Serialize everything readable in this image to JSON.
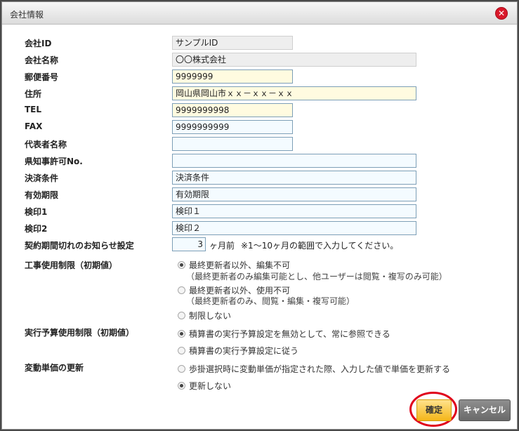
{
  "dialog": {
    "title": "会社情報",
    "close_glyph": "✕"
  },
  "fields": [
    {
      "label": "会社ID",
      "value": "サンプルID"
    },
    {
      "label": "会社名称",
      "value": "〇〇株式会社"
    },
    {
      "label": "郵便番号",
      "value": "9999999"
    },
    {
      "label": "住所",
      "value": "岡山県岡山市ｘｘ－ｘｘ－ｘｘ"
    },
    {
      "label": "TEL",
      "value": "9999999998"
    },
    {
      "label": "FAX",
      "value": "9999999999"
    },
    {
      "label": "代表者名称",
      "value": ""
    },
    {
      "label": "県知事許可No.",
      "value": ""
    },
    {
      "label": "決済条件",
      "value": "決済条件"
    },
    {
      "label": "有効期限",
      "value": "有効期限"
    },
    {
      "label": "検印1",
      "value": "検印１"
    },
    {
      "label": "検印2",
      "value": "検印２"
    }
  ],
  "notice": {
    "label": "契約期間切れのお知らせ設定",
    "value": "3",
    "unit": "ヶ月前",
    "hint": "※1～10ヶ月の範囲で入力してください。"
  },
  "construction_limit": {
    "label": "工事使用制限（初期値）",
    "options": [
      {
        "label": "最終更新者以外、編集不可",
        "sub": "（最終更新者のみ編集可能とし、他ユーザーは閲覧・複写のみ可能）",
        "checked": true
      },
      {
        "label": "最終更新者以外、使用不可",
        "sub": "（最終更新者のみ、閲覧・編集・複写可能）",
        "checked": false
      },
      {
        "label": "制限しない",
        "sub": "",
        "checked": false
      }
    ]
  },
  "budget_limit": {
    "label": "実行予算使用制限（初期値）",
    "options": [
      {
        "label": "積算書の実行予算設定を無効として、常に参照できる",
        "checked": true
      },
      {
        "label": "積算書の実行予算設定に従う",
        "checked": false
      }
    ]
  },
  "unit_price_update": {
    "label": "変動単価の更新",
    "options": [
      {
        "label": "歩掛選択時に変動単価が指定された際、入力した値で単価を更新する",
        "checked": false
      },
      {
        "label": "更新しない",
        "checked": true
      }
    ]
  },
  "buttons": {
    "ok": "確定",
    "cancel": "キャンセル"
  },
  "colors": {
    "required_bg": "#fffbe0",
    "ok_button": "#f4b619",
    "highlight": "#e0001b"
  }
}
